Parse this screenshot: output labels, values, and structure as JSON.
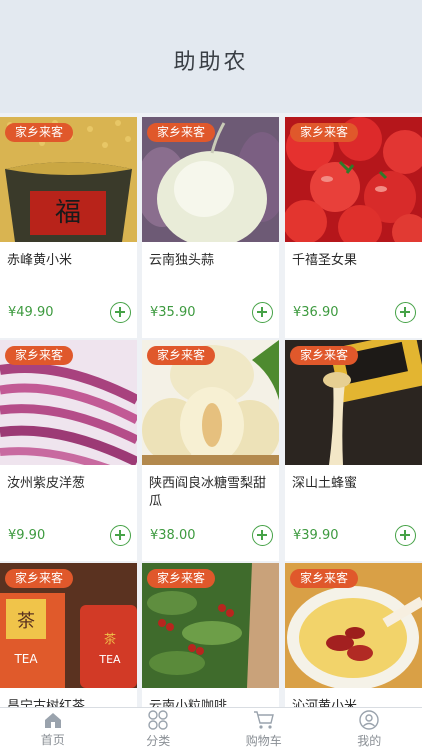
{
  "header": {
    "title": "助助农"
  },
  "badge_text": "家乡来客",
  "products": [
    {
      "name": "赤峰黄小米",
      "price": "¥49.90",
      "image": "millet-bowl"
    },
    {
      "name": "云南独头蒜",
      "price": "¥35.90",
      "image": "garlic"
    },
    {
      "name": "千禧圣女果",
      "price": "¥36.90",
      "image": "cherry-tomatoes"
    },
    {
      "name": "汝州紫皮洋葱",
      "price": "¥9.90",
      "image": "red-onion"
    },
    {
      "name": "陕西阎良冰糖雪梨甜瓜",
      "price": "¥38.00",
      "image": "melon"
    },
    {
      "name": "深山土蜂蜜",
      "price": "¥39.90",
      "image": "honey"
    },
    {
      "name": "昌宁古树红茶",
      "price": "",
      "image": "tea-cans"
    },
    {
      "name": "云南小粒咖啡",
      "price": "",
      "image": "coffee-plant"
    },
    {
      "name": "沁河黄小米",
      "price": "",
      "image": "millet-porridge"
    }
  ],
  "tabbar": {
    "tabs": [
      {
        "label": "首页",
        "icon": "home-icon",
        "active": true
      },
      {
        "label": "分类",
        "icon": "category-icon",
        "active": false
      },
      {
        "label": "购物车",
        "icon": "cart-icon",
        "active": false
      },
      {
        "label": "我的",
        "icon": "profile-icon",
        "active": false
      }
    ]
  },
  "colors": {
    "accent": "#46a247",
    "badge": "#e0582b",
    "price": "#3d9a3f",
    "header_bg": "#e3e9f0"
  }
}
